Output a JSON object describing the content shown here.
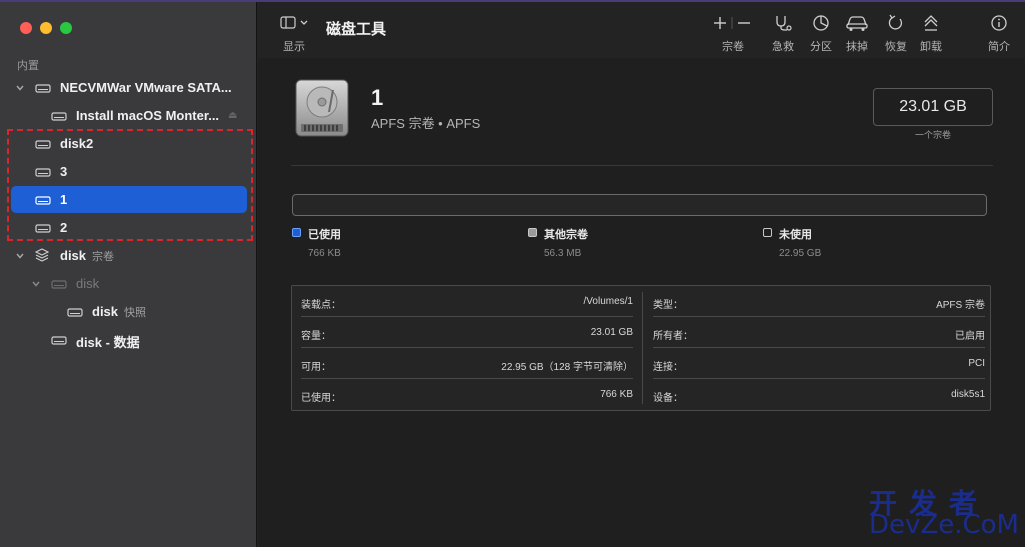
{
  "sidebar": {
    "section_label": "内置",
    "items": [
      {
        "label": "NECVMWar VMware SATA...",
        "sub": ""
      },
      {
        "label": "Install macOS Monter...",
        "sub": ""
      },
      {
        "label": "disk2",
        "sub": ""
      },
      {
        "label": "3",
        "sub": ""
      },
      {
        "label": "1",
        "sub": ""
      },
      {
        "label": "2",
        "sub": ""
      },
      {
        "label": "disk",
        "sub": "宗卷"
      },
      {
        "label": "disk",
        "sub": ""
      },
      {
        "label": "disk",
        "sub": "快照"
      },
      {
        "label": "disk - 数据",
        "sub": ""
      }
    ]
  },
  "toolbar": {
    "view_label": "显示",
    "title": "磁盘工具",
    "buttons": [
      {
        "label": "宗卷",
        "icon": "plus-minus-icon"
      },
      {
        "label": "急救",
        "icon": "stethoscope-icon"
      },
      {
        "label": "分区",
        "icon": "pie-chart-icon"
      },
      {
        "label": "抹掉",
        "icon": "car-eraser-icon"
      },
      {
        "label": "恢复",
        "icon": "restore-arrow-icon"
      },
      {
        "label": "卸载",
        "icon": "eject-icon"
      },
      {
        "label": "简介",
        "icon": "info-icon"
      }
    ]
  },
  "volume": {
    "name": "1",
    "subtitle": "APFS 宗卷 • APFS",
    "size": "23.01 GB",
    "size_caption": "一个宗卷"
  },
  "usage": {
    "used_label": "已使用",
    "used_value": "766 KB",
    "other_label": "其他宗卷",
    "other_value": "56.3 MB",
    "free_label": "未使用",
    "free_value": "22.95 GB",
    "used_color": "#2f7fe0"
  },
  "info": {
    "left": [
      {
        "k": "装载点：",
        "v": "/Volumes/1"
      },
      {
        "k": "容量：",
        "v": "23.01 GB"
      },
      {
        "k": "可用：",
        "v": "22.95 GB（128 字节可清除）"
      },
      {
        "k": "已使用：",
        "v": "766 KB"
      }
    ],
    "right": [
      {
        "k": "类型：",
        "v": "APFS 宗卷"
      },
      {
        "k": "所有者：",
        "v": "已启用"
      },
      {
        "k": "连接：",
        "v": "PCI"
      },
      {
        "k": "设备：",
        "v": "disk5s1"
      }
    ]
  },
  "watermark": {
    "cn": "开发者",
    "en": "DevZe.CoM"
  }
}
